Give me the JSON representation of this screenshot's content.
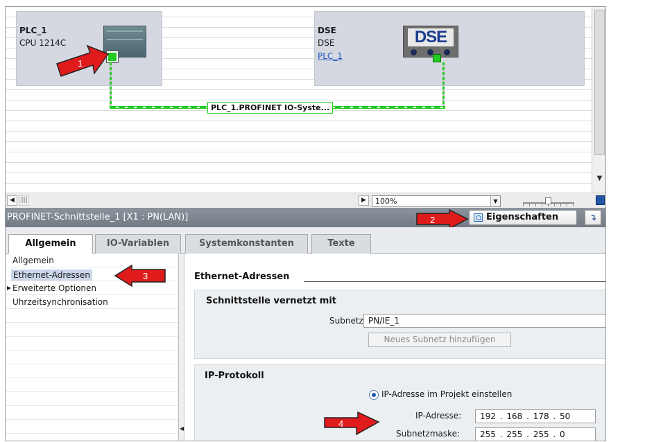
{
  "network": {
    "plc": {
      "name": "PLC_1",
      "type": "CPU 1214C"
    },
    "dse": {
      "name": "DSE",
      "type": "DSE",
      "link": "PLC_1",
      "logo": "DSE"
    },
    "subnet_label": "PLC_1.PROFINET IO-Syste...",
    "zoom": "100%"
  },
  "inspector": {
    "title": "PROFINET-Schnittstelle_1 [X1 : PN(LAN)]",
    "properties_button": "Eigenschaften",
    "tabs": [
      {
        "label": "Allgemein",
        "active": true
      },
      {
        "label": "IO-Variablen",
        "active": false
      },
      {
        "label": "Systemkonstanten",
        "active": false
      },
      {
        "label": "Texte",
        "active": false
      }
    ],
    "tree": [
      {
        "label": "Allgemein"
      },
      {
        "label": "Ethernet-Adressen",
        "selected": true
      },
      {
        "label": "Erweiterte Optionen",
        "expandable": true
      },
      {
        "label": "Uhrzeitsynchronisation"
      }
    ]
  },
  "content": {
    "section_title": "Ethernet-Adressen",
    "interface_group": {
      "title": "Schnittstelle vernetzt mit",
      "subnet_label": "Subnetz:",
      "subnet_value": "PN/IE_1",
      "add_subnet_button": "Neues Subnetz hinzufügen"
    },
    "ip_group": {
      "title": "IP-Protokoll",
      "radio_label": "IP-Adresse im Projekt einstellen",
      "ip_label": "IP-Adresse:",
      "ip_value": "192 . 168 . 178 . 50",
      "mask_label": "Subnetzmaske:",
      "mask_value": "255 . 255 . 255 . 0"
    }
  },
  "annotations": [
    {
      "number": "1"
    },
    {
      "number": "2"
    },
    {
      "number": "3"
    },
    {
      "number": "4"
    }
  ],
  "colors": {
    "accent_red": "#e01b1b",
    "profinet_green": "#22cc22",
    "inspector_header": "#7f8791",
    "device_box": "#d5d8e0",
    "selection": "#cbd7e8"
  }
}
